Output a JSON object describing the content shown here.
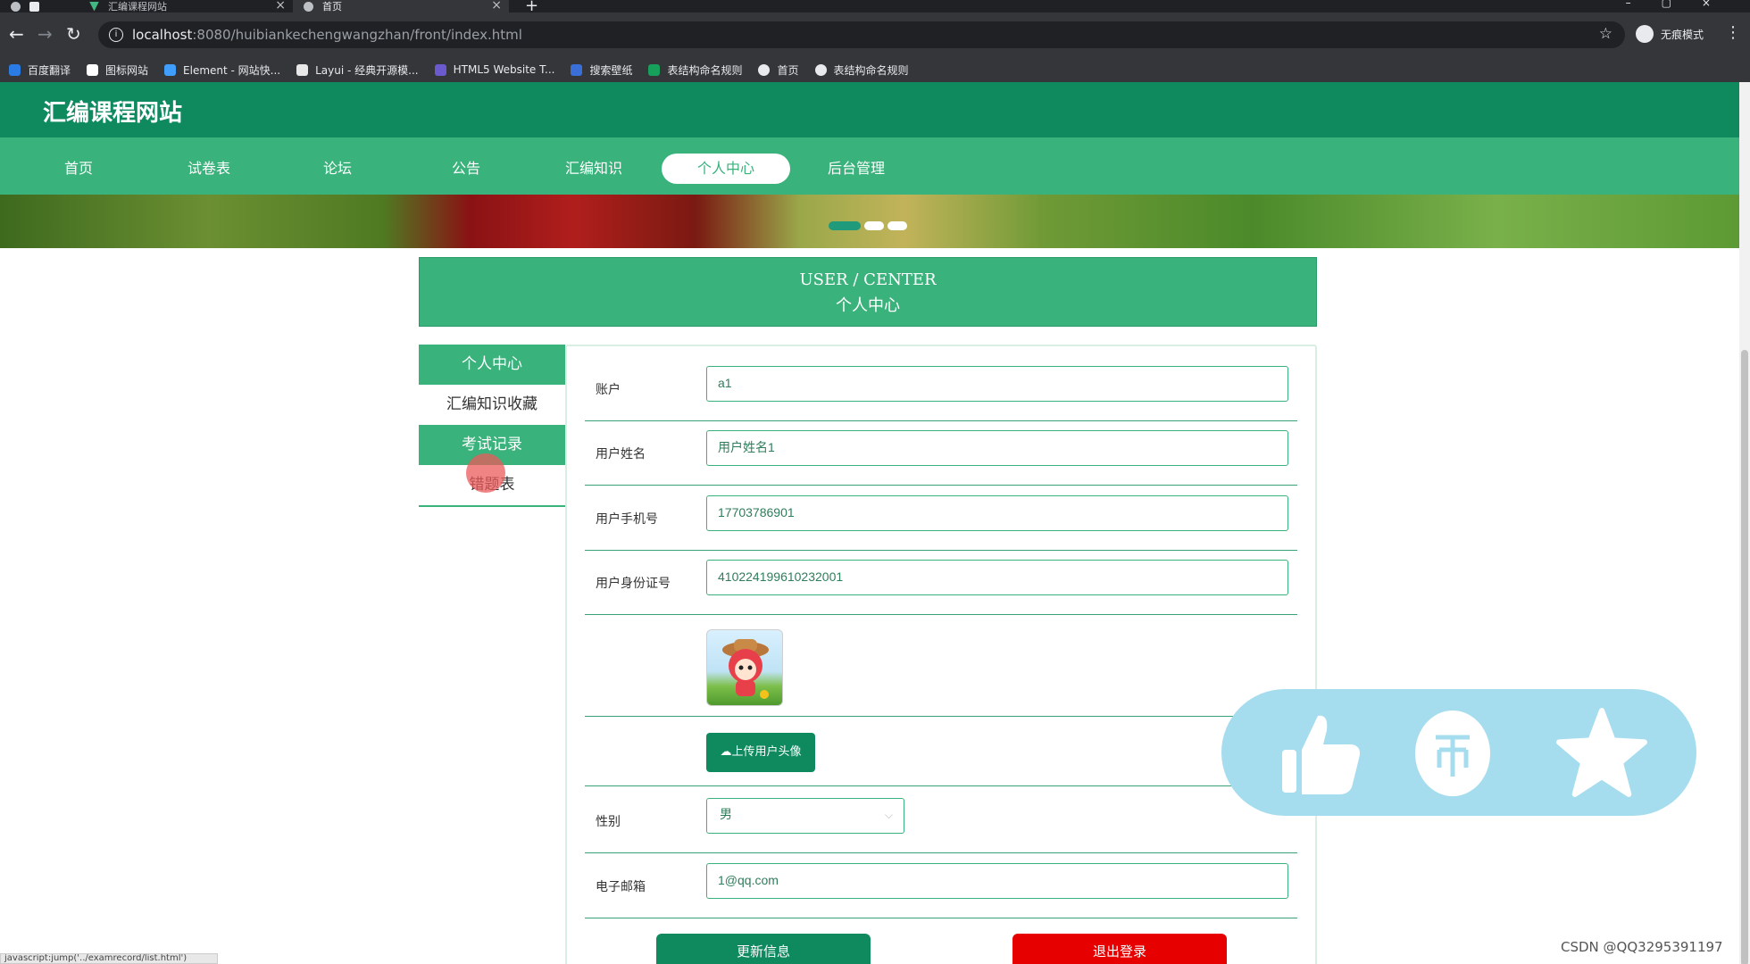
{
  "browser": {
    "tabs": [
      {
        "title": "汇编课程网站",
        "active": false
      },
      {
        "title": "首页",
        "active": true
      }
    ],
    "new_tab": "+",
    "url_host": "localhost",
    "url_path": ":8080/huibiankechengwangzhan/front/index.html",
    "profile_label": "无痕模式",
    "bookmarks": [
      "百度翻译",
      "图标网站",
      "Element - 网站快...",
      "Layui - 经典开源模...",
      "HTML5 Website T...",
      "搜索壁纸",
      "表结构命名规则",
      "首页",
      "表结构命名规则"
    ]
  },
  "site": {
    "title": "汇编课程网站",
    "nav": [
      "首页",
      "试卷表",
      "论坛",
      "公告",
      "汇编知识",
      "个人中心",
      "后台管理"
    ],
    "active_nav": "个人中心"
  },
  "user_center": {
    "title_en": "USER / CENTER",
    "title_cn": "个人中心",
    "menu": [
      "个人中心",
      "汇编知识收藏",
      "考试记录",
      "错题表"
    ]
  },
  "form": {
    "account_label": "账户",
    "account_value": "a1",
    "name_label": "用户姓名",
    "name_value": "用户姓名1",
    "phone_label": "用户手机号",
    "phone_value": "17703786901",
    "id_label": "用户身份证号",
    "id_value": "410224199610232001",
    "upload_label": "上传用户头像",
    "gender_label": "性别",
    "gender_value": "男",
    "email_label": "电子邮箱",
    "email_value": "1@qq.com",
    "update_button": "更新信息",
    "logout_button": "退出登录"
  },
  "status_bar": "javascript:jump('../examrecord/list.html')",
  "watermark": "CSDN @QQ3295391197",
  "colors": {
    "primary": "#0f8a5f",
    "nav": "#3ab27c",
    "danger": "#e60000",
    "float_bar": "#a5ddef"
  }
}
